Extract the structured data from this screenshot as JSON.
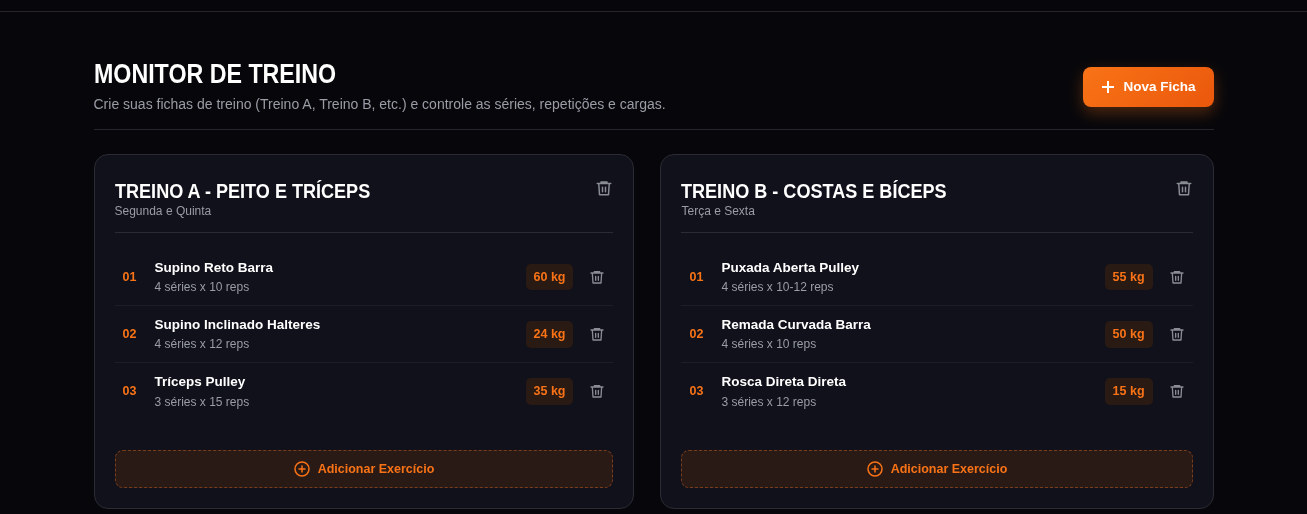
{
  "header": {
    "title": "MONITOR DE TREINO",
    "subtitle": "Crie suas fichas de treino (Treino A, Treino B, etc.) e controle as séries, repetições e cargas.",
    "new_button": "Nova Ficha"
  },
  "plans": [
    {
      "title": "TREINO A - PEITO E TRÍCEPS",
      "days": "Segunda e Quinta",
      "add_button": "Adicionar Exercício",
      "exercises": [
        {
          "number": "01",
          "name": "Supino Reto Barra",
          "detail": "4 séries x 10 reps",
          "load": "60 kg"
        },
        {
          "number": "02",
          "name": "Supino Inclinado Halteres",
          "detail": "4 séries x 12 reps",
          "load": "24 kg"
        },
        {
          "number": "03",
          "name": "Tríceps Pulley",
          "detail": "3 séries x 15 reps",
          "load": "35 kg"
        }
      ]
    },
    {
      "title": "TREINO B - COSTAS E BÍCEPS",
      "days": "Terça e Sexta",
      "add_button": "Adicionar Exercício",
      "exercises": [
        {
          "number": "01",
          "name": "Puxada Aberta Pulley",
          "detail": "4 séries x 10-12 reps",
          "load": "55 kg"
        },
        {
          "number": "02",
          "name": "Remada Curvada Barra",
          "detail": "4 séries x 10 reps",
          "load": "50 kg"
        },
        {
          "number": "03",
          "name": "Rosca Direta Direta",
          "detail": "3 séries x 12 reps",
          "load": "15 kg"
        }
      ]
    }
  ]
}
